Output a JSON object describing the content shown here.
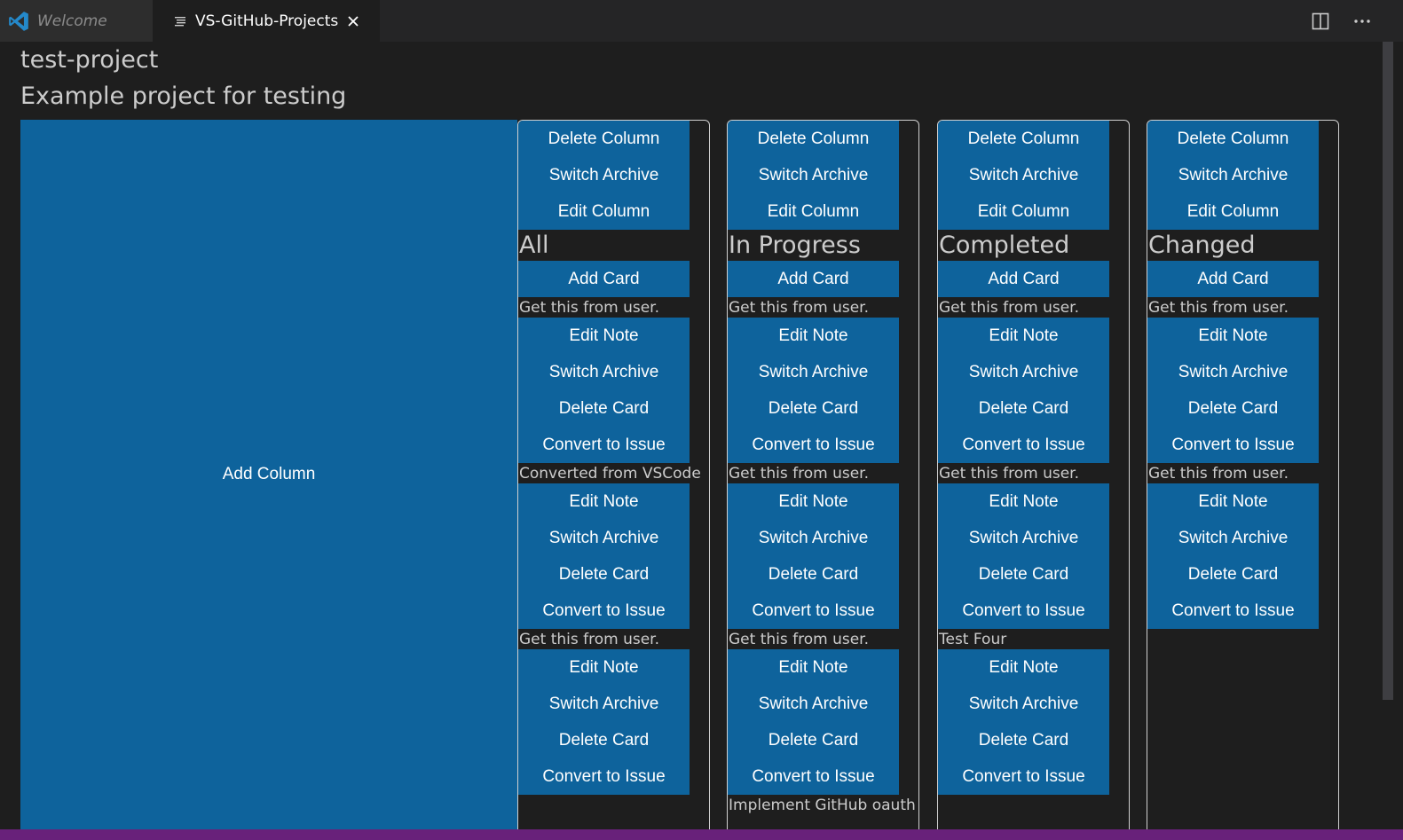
{
  "tabs": [
    {
      "label": "Welcome",
      "icon": "vscode-logo-icon",
      "active": false
    },
    {
      "label": "VS-GitHub-Projects",
      "icon": "preview-icon",
      "active": true
    }
  ],
  "actions": {
    "split": "split-editor-icon",
    "more": "more-actions-icon"
  },
  "project": {
    "title": "test-project",
    "description": "Example project for testing"
  },
  "add_column_label": "Add Column",
  "column_buttons": [
    "Delete Column",
    "Switch Archive",
    "Edit Column"
  ],
  "add_card_label": "Add Card",
  "card_buttons": [
    "Edit Note",
    "Switch Archive",
    "Delete Card",
    "Convert to Issue"
  ],
  "columns": [
    {
      "title": "All",
      "cards": [
        {
          "note": "Get this from user."
        },
        {
          "note": "Converted from VSCode"
        },
        {
          "note": "Get this from user."
        }
      ]
    },
    {
      "title": "In Progress",
      "cards": [
        {
          "note": "Get this from user."
        },
        {
          "note": "Get this from user."
        },
        {
          "note": "Get this from user."
        },
        {
          "note": "Implement GitHub oauth"
        }
      ]
    },
    {
      "title": "Completed",
      "cards": [
        {
          "note": "Get this from user."
        },
        {
          "note": "Get this from user."
        },
        {
          "note": "Test Four"
        }
      ]
    },
    {
      "title": "Changed",
      "cards": [
        {
          "note": "Get this from user."
        },
        {
          "note": "Get this from user."
        }
      ]
    }
  ],
  "colors": {
    "accent_button": "#0e639c",
    "editor_bg": "#1e1e1e",
    "status_bar": "#68217a"
  }
}
